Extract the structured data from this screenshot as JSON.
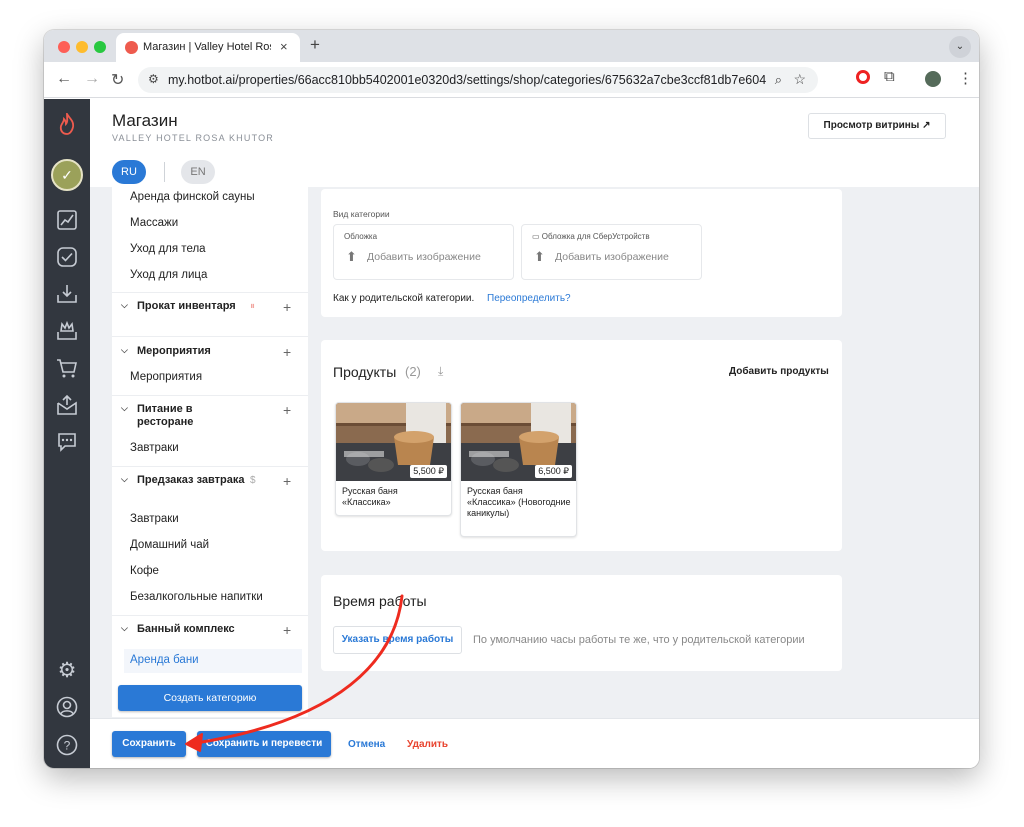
{
  "browser": {
    "tab_title": "Магазин | Valley Hotel Rosa Khutor",
    "tab_close": "×",
    "new_tab": "+",
    "url": "my.hotbot.ai/properties/66acc810bb5402001e0320d3/settings/shop/categories/675632a7cbe3ccf81db7e604"
  },
  "header": {
    "title": "Магазин",
    "subtitle": "VALLEY HOTEL ROSA KHUTOR",
    "preview_button": "Просмотр витрины ↗",
    "lang_ru": "RU",
    "lang_en": "EN"
  },
  "sidebar": {
    "items_top": [
      "Аренда финской сауны",
      "Массажи",
      "Уход для тела",
      "Уход для лица"
    ],
    "group_rental": {
      "label": "Прокат инвентаря",
      "badge": "⏸",
      "add": "+"
    },
    "group_events": {
      "label": "Мероприятия",
      "add": "+",
      "items": [
        "Мероприятия"
      ]
    },
    "group_food": {
      "label": "Питание в ресторане",
      "add": "+",
      "items": [
        "Завтраки"
      ]
    },
    "group_preorder": {
      "label": "Предзаказ завтрака",
      "badge": "$",
      "add": "+",
      "items": [
        "Завтраки",
        "Домашний чай",
        "Кофе",
        "Безалкогольные напитки"
      ]
    },
    "group_bath": {
      "label": "Банный комплекс",
      "add": "+",
      "items": [
        "Аренда бани"
      ]
    },
    "create_button": "Создать категорию"
  },
  "category_view": {
    "label": "Вид категории",
    "cover_caption": "Обложка",
    "cover_action": "Добавить изображение",
    "sber_caption": "Обложка для СберУстройств",
    "sber_action": "Добавить изображение",
    "inherit_text": "Как у родительской категории.",
    "override_link": "Переопределить?"
  },
  "products": {
    "title": "Продукты",
    "count": "(2)",
    "add_link": "Добавить продукты",
    "items": [
      {
        "name": "Русская баня «Классика»",
        "price": "5,500 ₽"
      },
      {
        "name": "Русская баня «Классика» (Новогодние каникулы)",
        "price": "6,500 ₽"
      }
    ]
  },
  "hours": {
    "title": "Время работы",
    "set_button": "Указать время работы",
    "default_text": "По умолчанию часы работы те же, что у родительской категории"
  },
  "footer": {
    "save": "Сохранить",
    "save_translate": "Сохранить и перевести",
    "cancel": "Отмена",
    "delete": "Удалить"
  },
  "colors": {
    "accent": "#2a79d6",
    "danger": "#e8432e",
    "sidebar_dark": "#32373f",
    "annotation": "#ee2b1f"
  }
}
